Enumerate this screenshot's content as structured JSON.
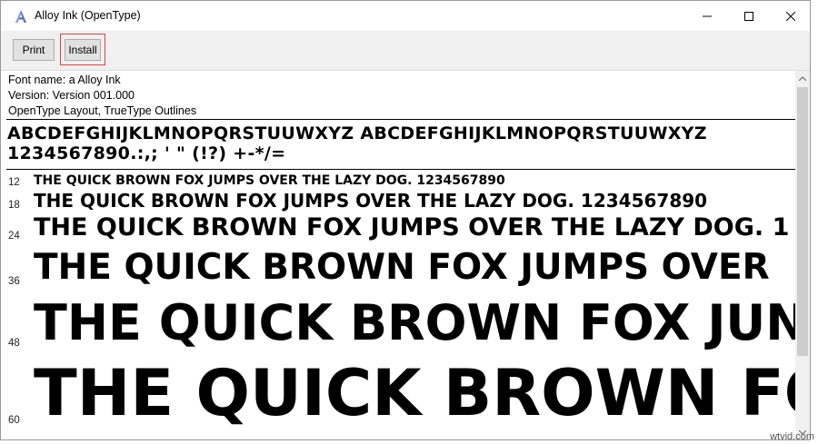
{
  "window": {
    "title": "Alloy Ink (OpenType)",
    "app_icon": "font-viewer-icon"
  },
  "toolbar": {
    "print_label": "Print",
    "install_label": "Install"
  },
  "font_info": {
    "name_line": "Font name: a Alloy Ink",
    "version_line": "Version: Version 001.000",
    "type_line": "OpenType Layout, TrueType Outlines"
  },
  "character_set": {
    "line1": "ABCDEFGHIJKLMNOPQRSTUUWXYZ ABCDEFGHIJKLMNOPQRSTUUWXYZ",
    "line2": "1234567890.:,; ' \" (!?) +-*/="
  },
  "samples": [
    {
      "size": "12",
      "text": "THE QUICK BROWN FOX JUMPS OVER THE LAZY DOG. 1234567890"
    },
    {
      "size": "18",
      "text": "THE QUICK BROWN FOX JUMPS OVER THE LAZY DOG. 1234567890"
    },
    {
      "size": "24",
      "text": "THE QUICK BROWN FOX JUMPS OVER THE LAZY DOG. 1"
    },
    {
      "size": "36",
      "text": "THE QUICK BROWN FOX JUMPS OVER"
    },
    {
      "size": "48",
      "text": "THE QUICK BROWN FOX JUN"
    },
    {
      "size": "60",
      "text": "THE QUICK BROWN FO"
    }
  ],
  "watermark": "wtvid.com"
}
